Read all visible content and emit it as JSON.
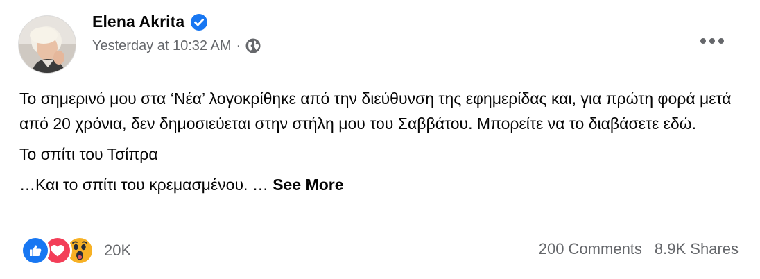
{
  "post": {
    "author_name": "Elena Akrita",
    "timestamp": "Yesterday at 10:32 AM",
    "separator": "·",
    "paragraphs": [
      "Το σημερινό μου στα ‘Νέα’ λογοκρίθηκε από την διεύθυνση της εφημερίδας και, για πρώτη φορά μετά από 20 χρόνια, δεν δημοσιεύεται στην στήλη μου του Σαββάτου. Μπορείτε να το διαβάσετε εδώ.",
      "Το σπίτι του Τσίπρα"
    ],
    "last_line": "…Και το σπίτι του κρεμασμένου. …",
    "see_more_label": "See More"
  },
  "reactions": {
    "types": [
      "like-icon",
      "love-icon",
      "wow-icon"
    ],
    "count": "20K"
  },
  "stats": {
    "comments": "200 Comments",
    "shares": "8.9K Shares"
  },
  "colors": {
    "verified_blue": "#1877f2",
    "secondary_text": "#65676b",
    "love_red": "#f33e58",
    "wow_yellow": "#f7b125"
  }
}
